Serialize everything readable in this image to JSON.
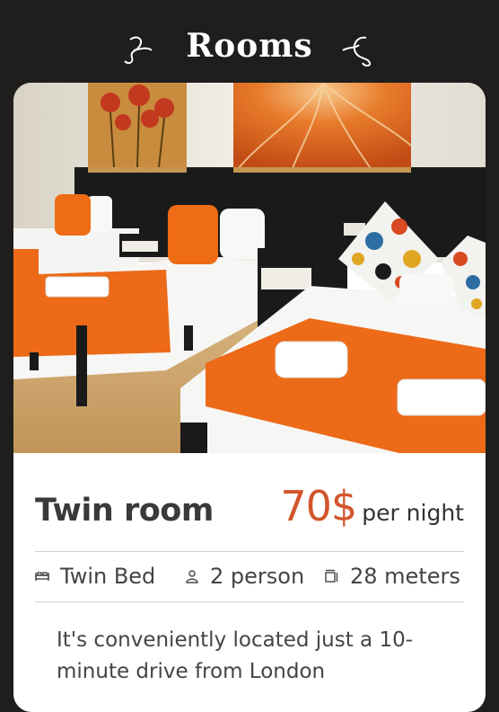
{
  "section": {
    "title": "Rooms",
    "ornament_left": "swirl-ornament-left",
    "ornament_right": "swirl-ornament-right"
  },
  "room": {
    "name": "Twin room",
    "price": "70$",
    "price_unit": "per night",
    "image": "twin-bedroom-photo",
    "features": [
      {
        "icon": "bed-icon",
        "label": "Twin Bed"
      },
      {
        "icon": "person-icon",
        "label": "2 person"
      },
      {
        "icon": "room-size-icon",
        "label": "28 meters"
      }
    ],
    "description": "It's conveniently located just a 10-minute drive from London"
  },
  "colors": {
    "background": "#1f1e1d",
    "accent": "#d2562d",
    "card": "#ffffff",
    "text": "#3a3a3a",
    "divider": "#cfcfcf"
  }
}
